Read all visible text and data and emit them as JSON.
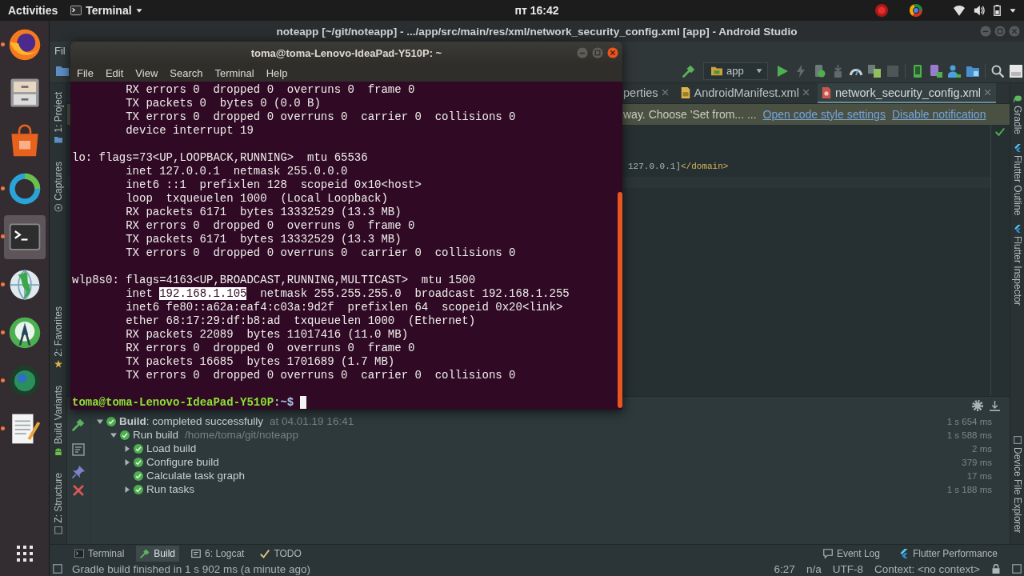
{
  "top_bar": {
    "activities": "Activities",
    "app_menu": "Terminal",
    "clock": "пт 16:42"
  },
  "dock": {
    "items": [
      {
        "kind": "browser",
        "selected": false,
        "running": true
      },
      {
        "kind": "files",
        "selected": false,
        "running": false
      },
      {
        "kind": "software",
        "selected": false,
        "running": false
      },
      {
        "kind": "ring",
        "selected": false,
        "running": true
      },
      {
        "kind": "terminal",
        "selected": true,
        "running": true
      },
      {
        "kind": "globe",
        "selected": false,
        "running": true
      },
      {
        "kind": "studio",
        "selected": false,
        "running": true
      },
      {
        "kind": "sphere",
        "selected": false,
        "running": true
      },
      {
        "kind": "notepad",
        "selected": false,
        "running": true
      }
    ]
  },
  "ide": {
    "title": "noteapp [~/git/noteapp] - .../app/src/main/res/xml/network_security_config.xml [app] - Android Studio",
    "menu": [
      "Fil"
    ],
    "run_config": "app",
    "left_tools_top": [
      {
        "kind": "project",
        "label": "1: Project"
      },
      {
        "kind": "captures",
        "label": "Captures"
      }
    ],
    "left_tools_bottom": [
      {
        "kind": "favorites",
        "label": "2: Favorites"
      },
      {
        "kind": "variants",
        "label": "Build Variants"
      },
      {
        "kind": "structure",
        "label": "Z: Structure"
      }
    ],
    "right_tools_top": [
      {
        "kind": "gradle",
        "label": "Gradle"
      },
      {
        "kind": "outline",
        "label": "Flutter Outline"
      },
      {
        "kind": "inspector",
        "label": "Flutter Inspector"
      }
    ],
    "right_tools_bottom": [
      {
        "kind": "explorer",
        "label": "Device File Explorer"
      }
    ],
    "tabs": [
      {
        "kind": "properties",
        "label": "perties",
        "selected": false
      },
      {
        "kind": "manifest",
        "label": "AndroidManifest.xml",
        "selected": false
      },
      {
        "kind": "xml",
        "label": "network_security_config.xml",
        "selected": true
      }
    ],
    "notification": {
      "text": "way. Choose 'Set from... ...",
      "links": [
        "Open code style settings",
        "Disable notification"
      ]
    },
    "editor": {
      "lines": [
        {
          "text": "127.0.0.1]",
          "tag": "</domain>"
        }
      ]
    },
    "build": {
      "tree": [
        {
          "label": "**Build**: completed successfully",
          "note": "at 04.01.19 16:41",
          "duration": "1 s 654 ms",
          "expanded": true,
          "children": [
            {
              "label": "Run build",
              "note": "/home/toma/git/noteapp",
              "duration": "1 s 588 ms",
              "expanded": true,
              "children": [
                {
                  "label": "Load build",
                  "duration": "2 ms",
                  "expanded": false
                },
                {
                  "label": "Configure build",
                  "duration": "379 ms",
                  "expanded": false
                },
                {
                  "label": "Calculate task graph",
                  "duration": "17 ms"
                },
                {
                  "label": "Run tasks",
                  "duration": "1 s 188 ms",
                  "expanded": false
                }
              ]
            }
          ]
        }
      ]
    },
    "tool_tabs": [
      {
        "kind": "terminal",
        "label": "Terminal",
        "selected": false
      },
      {
        "kind": "build",
        "label": "Build",
        "selected": true
      },
      {
        "kind": "logcat",
        "label": "6: Logcat",
        "selected": false
      },
      {
        "kind": "todo",
        "label": "TODO",
        "selected": false
      }
    ],
    "tool_tabs_right": [
      {
        "kind": "log",
        "label": "Event Log"
      },
      {
        "kind": "flutter",
        "label": "Flutter Performance"
      }
    ],
    "status": {
      "message": "Gradle build finished in 1 s 902 ms (a minute ago)",
      "position": "6:27",
      "line_separator": "n/a",
      "encoding": "UTF-8",
      "context": "Context: <no context>"
    }
  },
  "terminal": {
    "title": "toma@toma-Lenovo-IdeaPad-Y510P: ~",
    "menu": [
      "File",
      "Edit",
      "View",
      "Search",
      "Terminal",
      "Help"
    ],
    "blocks": [
      {
        "lines": [
          "RX errors 0  dropped 0  overruns 0  frame 0",
          "TX packets 0  bytes 0 (0.0 B)",
          "TX errors 0  dropped 0 overruns 0  carrier 0  collisions 0",
          "device interrupt 19"
        ]
      },
      {
        "header": "lo: flags=73<UP,LOOPBACK,RUNNING>  mtu 65536",
        "lines": [
          "inet 127.0.0.1  netmask 255.0.0.0",
          "inet6 ::1  prefixlen 128  scopeid 0x10<host>",
          "loop  txqueuelen 1000  (Local Loopback)",
          "RX packets 6171  bytes 13332529 (13.3 MB)",
          "RX errors 0  dropped 0  overruns 0  frame 0",
          "TX packets 6171  bytes 13332529 (13.3 MB)",
          "TX errors 0  dropped 0 overruns 0  carrier 0  collisions 0"
        ]
      },
      {
        "header": "wlp8s0: flags=4163<UP,BROADCAST,RUNNING,MULTICAST>  mtu 1500",
        "lines": [
          [
            {
              "text": "inet ",
              "selected": false
            },
            {
              "text": "192.168.1.105",
              "selected": true
            },
            {
              "text": "  netmask 255.255.255.0  broadcast 192.168.1.255",
              "selected": false
            }
          ],
          "inet6 fe80::a62a:eaf4:c03a:9d2f  prefixlen 64  scopeid 0x20<link>",
          "ether 68:17:29:df:b8:ad  txqueuelen 1000  (Ethernet)",
          "RX packets 22089  bytes 11017416 (11.0 MB)",
          "RX errors 0  dropped 0  overruns 0  frame 0",
          "TX packets 16685  bytes 1701689 (1.7 MB)",
          "TX errors 0  dropped 0 overruns 0  carrier 0  collisions 0"
        ]
      }
    ],
    "prompt": {
      "user_host": "toma@toma-Lenovo-IdeaPad-Y510P",
      "path": ":~$"
    }
  }
}
